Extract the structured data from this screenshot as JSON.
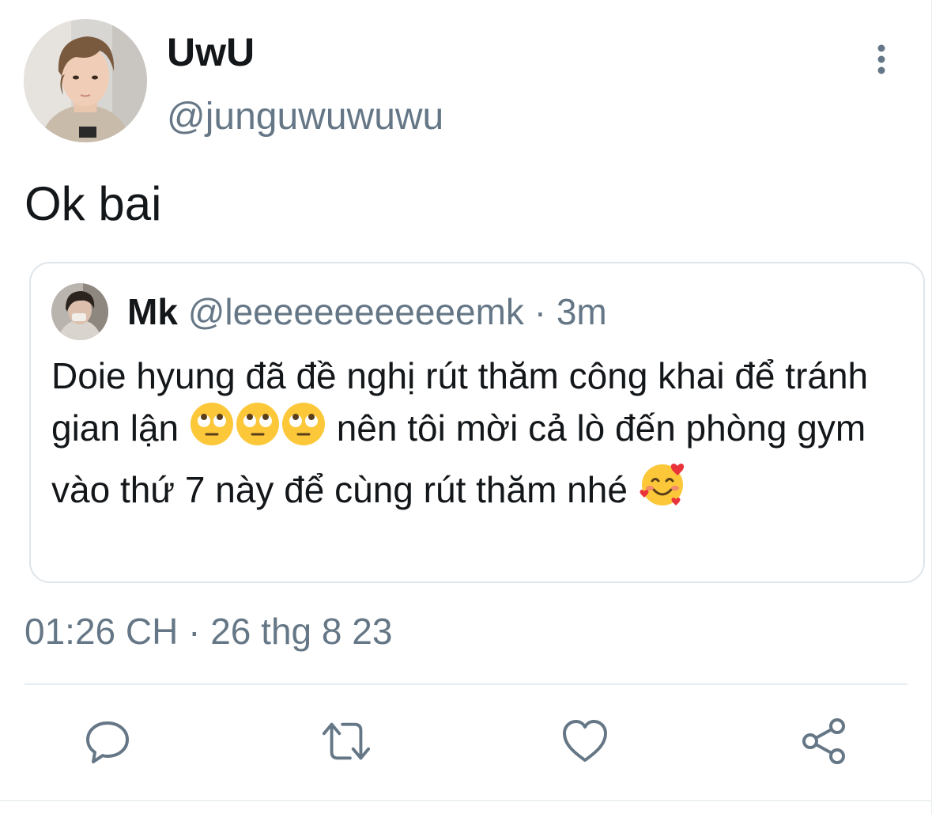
{
  "tweet": {
    "author": {
      "display_name": "UwU",
      "handle": "@junguwuwuwu",
      "avatar_icon": "profile-photo"
    },
    "text": "Ok bai",
    "timestamp": "01:26 CH · 26 thg 8 23",
    "more_icon": "more-vertical-icon"
  },
  "quoted_tweet": {
    "author": {
      "display_name": "Mk",
      "handle": "@leeeeeeeeeeeemk",
      "avatar_icon": "profile-photo"
    },
    "separator": "·",
    "age": "3m",
    "text_part1": "Doie hyung đã đề nghị rút thăm công khai để tránh gian lận",
    "emoji_1": "face-with-rolling-eyes",
    "emoji_2": "face-with-rolling-eyes",
    "emoji_3": "face-with-rolling-eyes",
    "text_part2": "nên tôi mời cả lò đến phòng gym vào thứ 7 này để cùng rút thăm nhé",
    "emoji_4": "smiling-face-with-hearts"
  },
  "actions": [
    {
      "name": "reply",
      "icon": "reply-icon"
    },
    {
      "name": "retweet",
      "icon": "retweet-icon"
    },
    {
      "name": "like",
      "icon": "heart-icon"
    },
    {
      "name": "share",
      "icon": "share-icon"
    }
  ],
  "colors": {
    "text_primary": "#14171a",
    "text_secondary": "#657786",
    "border": "#dfe5ea",
    "icon": "#657786"
  }
}
